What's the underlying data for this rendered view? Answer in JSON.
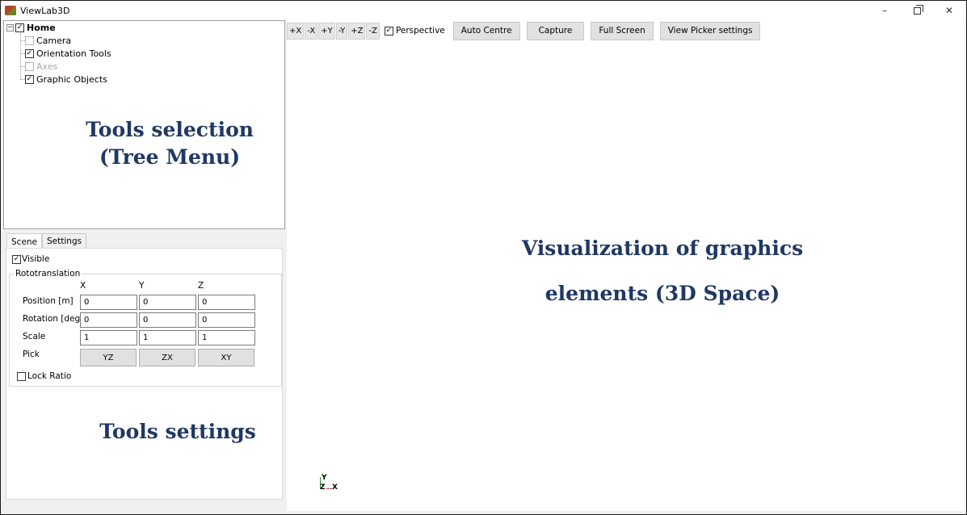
{
  "window": {
    "title": "ViewLab3D",
    "controls": {
      "minimize": "–",
      "close": "✕"
    }
  },
  "tree": {
    "root": {
      "label": "Home",
      "checked": true,
      "expander": "−"
    },
    "items": [
      {
        "label": "Camera",
        "checked": false,
        "disabled": false
      },
      {
        "label": "Orientation Tools",
        "checked": true,
        "disabled": false
      },
      {
        "label": "Axes",
        "checked": false,
        "disabled": true
      },
      {
        "label": "Graphic Objects",
        "checked": true,
        "disabled": false
      }
    ]
  },
  "annotations": {
    "tree_line1": "Tools selection",
    "tree_line2": "(Tree Menu)",
    "settings": "Tools settings",
    "viewport_line1": "Visualization of graphics",
    "viewport_line2": "elements (3D Space)"
  },
  "tabs": [
    {
      "label": "Scene",
      "active": true
    },
    {
      "label": "Settings",
      "active": false
    }
  ],
  "scene": {
    "visible_label": "Visible",
    "visible_checked": true,
    "group_title": "Rototranslation",
    "columns": [
      "X",
      "Y",
      "Z"
    ],
    "rows": [
      {
        "label": "Position [m]",
        "values": [
          "0",
          "0",
          "0"
        ]
      },
      {
        "label": "Rotation [deg]",
        "values": [
          "0",
          "0",
          "0"
        ]
      },
      {
        "label": "Scale",
        "values": [
          "1",
          "1",
          "1"
        ]
      }
    ],
    "pick_label": "Pick",
    "pick_buttons": [
      "YZ",
      "ZX",
      "XY"
    ],
    "lock_ratio_label": "Lock Ratio",
    "lock_ratio_checked": false
  },
  "toolbar": {
    "axis_buttons": [
      "+X",
      "-X",
      "+Y",
      "-Y",
      "+Z",
      "-Z"
    ],
    "perspective_label": "Perspective",
    "perspective_checked": true,
    "buttons": [
      "Auto Centre",
      "Capture",
      "Full Screen",
      "View Picker settings"
    ]
  },
  "gizmo": {
    "y": "Y",
    "z": "Z",
    "x": "X"
  },
  "colors": {
    "annotation": "#1f3864",
    "gizmo_y": "#2e8b2e",
    "gizmo_x": "#000000"
  }
}
